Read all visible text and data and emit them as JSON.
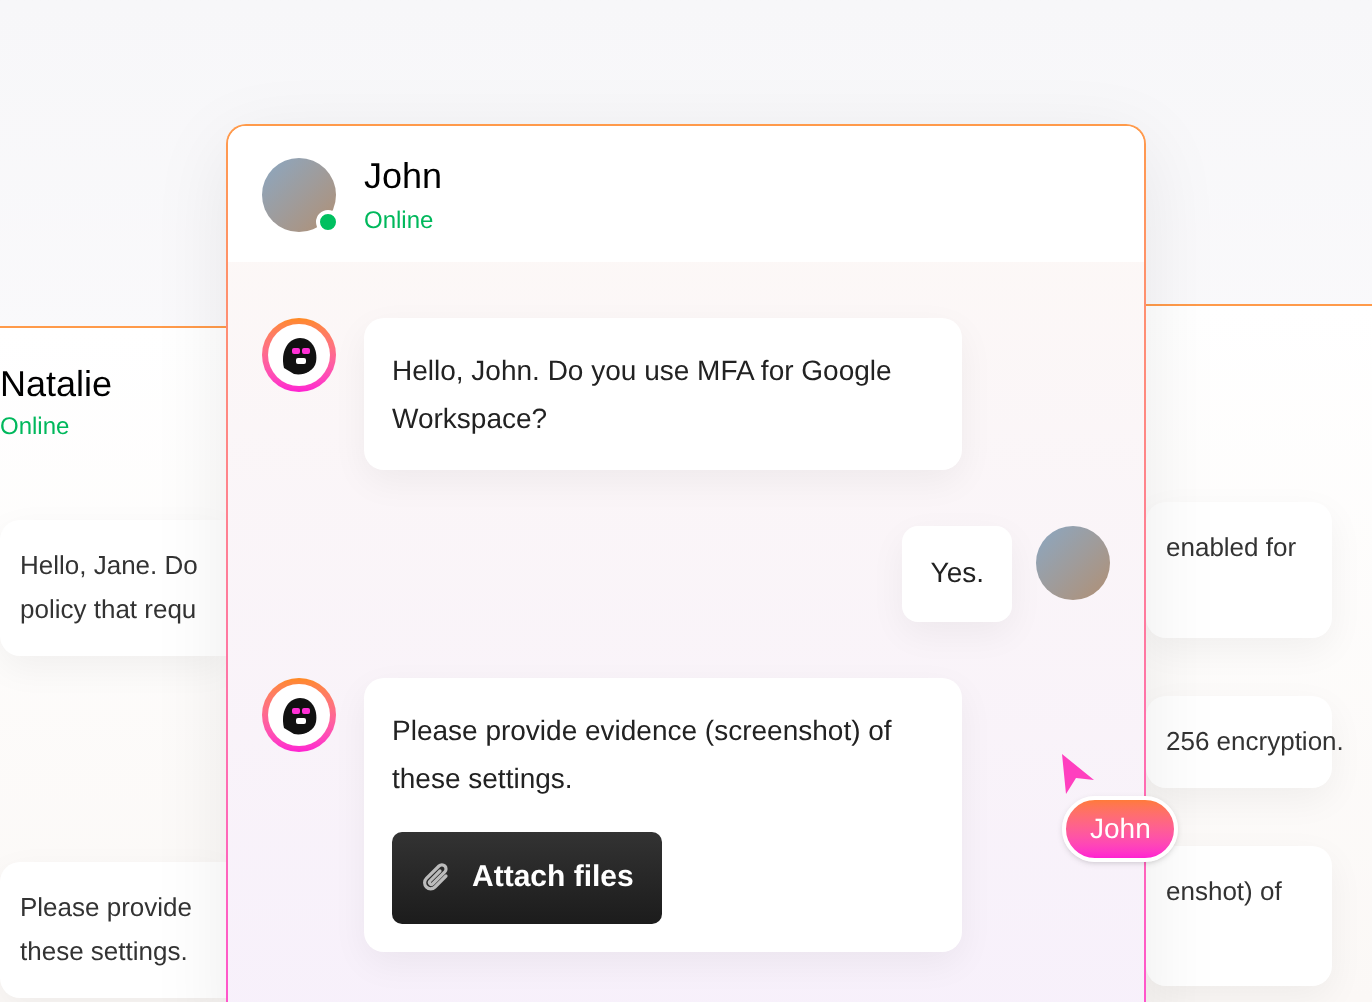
{
  "left_chat": {
    "contact": {
      "name": "Natalie",
      "status": "Online"
    },
    "messages": [
      {
        "lines": [
          "Hello, Jane. Do",
          "policy that requ"
        ]
      },
      {
        "lines": [
          "Please provide",
          "these settings."
        ]
      }
    ]
  },
  "right_chat": {
    "messages": [
      {
        "lines": [
          "enabled for"
        ]
      },
      {
        "lines": [
          "256 encryption."
        ]
      },
      {
        "lines": [
          "enshot) of"
        ]
      }
    ]
  },
  "chat": {
    "contact": {
      "name": "John",
      "status": "Online",
      "online": true
    },
    "messages": [
      {
        "kind": "incoming",
        "text": "Hello, John. Do you use MFA for Google Workspace?"
      },
      {
        "kind": "outgoing",
        "text": "Yes."
      },
      {
        "kind": "incoming",
        "text": "Please provide evidence (screenshot) of these settings.",
        "button": "Attach files"
      }
    ]
  },
  "cursor": {
    "label": "John"
  }
}
